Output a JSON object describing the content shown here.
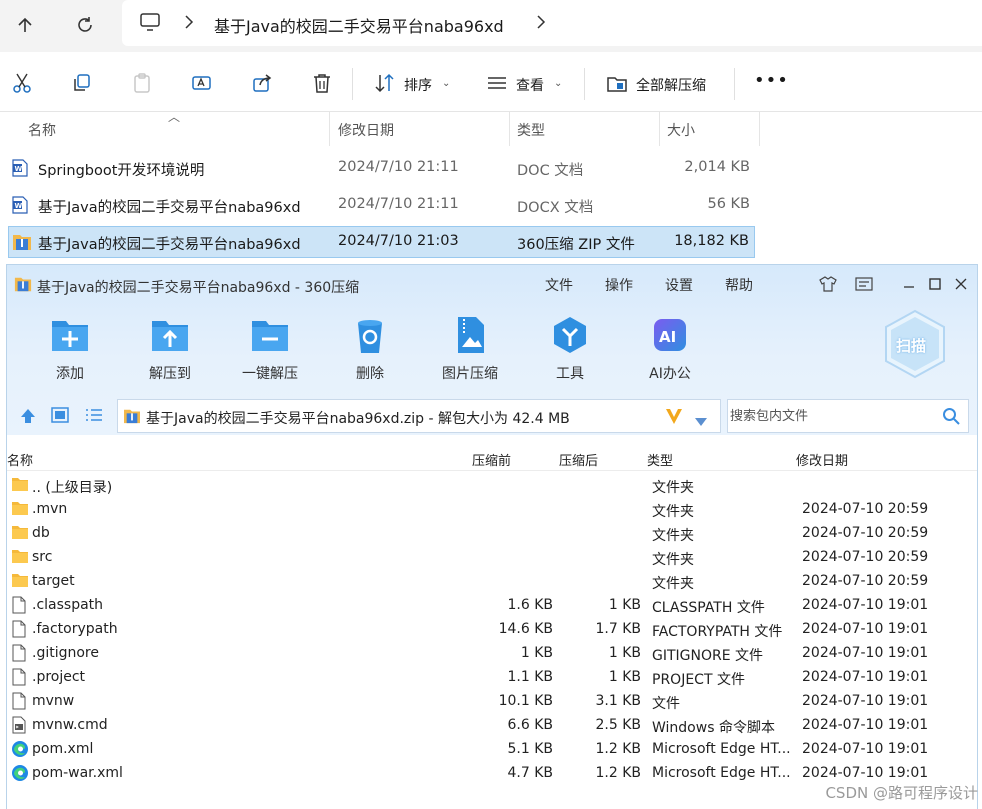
{
  "explorer": {
    "path_component": "基于Java的校园二手交易平台naba96xd",
    "toolbar": {
      "cut": "cut-icon",
      "copy": "copy-icon",
      "paste": "paste-icon",
      "rename": "rename-icon",
      "share": "share-icon",
      "delete": "delete-icon",
      "sort_label": "排序",
      "view_label": "查看",
      "extract_all_label": "全部解压缩",
      "more": "•••"
    },
    "columns": {
      "name": "名称",
      "modified": "修改日期",
      "type": "类型",
      "size": "大小"
    },
    "files": [
      {
        "name": "Springboot开发环境说明",
        "modified": "2024/7/10 21:11",
        "type": "DOC 文档",
        "size": "2,014 KB",
        "icon": "word-icon"
      },
      {
        "name": "基于Java的校园二手交易平台naba96xd",
        "modified": "2024/7/10 21:11",
        "type": "DOCX 文档",
        "size": "56 KB",
        "icon": "word-icon"
      },
      {
        "name": "基于Java的校园二手交易平台naba96xd",
        "modified": "2024/7/10 21:03",
        "type": "360压缩 ZIP 文件",
        "size": "18,182 KB",
        "icon": "zip-icon"
      }
    ]
  },
  "zip_window": {
    "title": "基于Java的校园二手交易平台naba96xd - 360压缩",
    "menu": [
      "文件",
      "操作",
      "设置",
      "帮助"
    ],
    "tools": [
      "添加",
      "解压到",
      "一键解压",
      "删除",
      "图片压缩",
      "工具",
      "AI办公"
    ],
    "scan_label": "扫描",
    "path_text": "基于Java的校园二手交易平台naba96xd.zip - 解包大小为 42.4 MB",
    "search_placeholder": "搜索包内文件",
    "columns": {
      "name": "名称",
      "before": "压缩前",
      "after": "压缩后",
      "type": "类型",
      "modified": "修改日期"
    },
    "rows": [
      {
        "name": ".. (上级目录)",
        "before": "",
        "after": "",
        "type": "文件夹",
        "modified": "",
        "icon": "folder-icon"
      },
      {
        "name": ".mvn",
        "before": "",
        "after": "",
        "type": "文件夹",
        "modified": "2024-07-10 20:59",
        "icon": "folder-icon"
      },
      {
        "name": "db",
        "before": "",
        "after": "",
        "type": "文件夹",
        "modified": "2024-07-10 20:59",
        "icon": "folder-icon"
      },
      {
        "name": "src",
        "before": "",
        "after": "",
        "type": "文件夹",
        "modified": "2024-07-10 20:59",
        "icon": "folder-icon"
      },
      {
        "name": "target",
        "before": "",
        "after": "",
        "type": "文件夹",
        "modified": "2024-07-10 20:59",
        "icon": "folder-icon"
      },
      {
        "name": ".classpath",
        "before": "1.6 KB",
        "after": "1 KB",
        "type": "CLASSPATH 文件",
        "modified": "2024-07-10 19:01",
        "icon": "file-icon"
      },
      {
        "name": ".factorypath",
        "before": "14.6 KB",
        "after": "1.7 KB",
        "type": "FACTORYPATH 文件",
        "modified": "2024-07-10 19:01",
        "icon": "file-icon"
      },
      {
        "name": ".gitignore",
        "before": "1 KB",
        "after": "1 KB",
        "type": "GITIGNORE 文件",
        "modified": "2024-07-10 19:01",
        "icon": "file-icon"
      },
      {
        "name": ".project",
        "before": "1.1 KB",
        "after": "1 KB",
        "type": "PROJECT 文件",
        "modified": "2024-07-10 19:01",
        "icon": "file-icon"
      },
      {
        "name": "mvnw",
        "before": "10.1 KB",
        "after": "3.1 KB",
        "type": "文件",
        "modified": "2024-07-10 19:01",
        "icon": "file-icon"
      },
      {
        "name": "mvnw.cmd",
        "before": "6.6 KB",
        "after": "2.5 KB",
        "type": "Windows 命令脚本",
        "modified": "2024-07-10 19:01",
        "icon": "cmd-icon"
      },
      {
        "name": "pom.xml",
        "before": "5.1 KB",
        "after": "1.2 KB",
        "type": "Microsoft Edge HT...",
        "modified": "2024-07-10 19:01",
        "icon": "edge-icon"
      },
      {
        "name": "pom-war.xml",
        "before": "4.7 KB",
        "after": "1.2 KB",
        "type": "Microsoft Edge HT...",
        "modified": "2024-07-10 19:01",
        "icon": "edge-icon"
      }
    ]
  },
  "watermark": "CSDN @路可程序设计"
}
